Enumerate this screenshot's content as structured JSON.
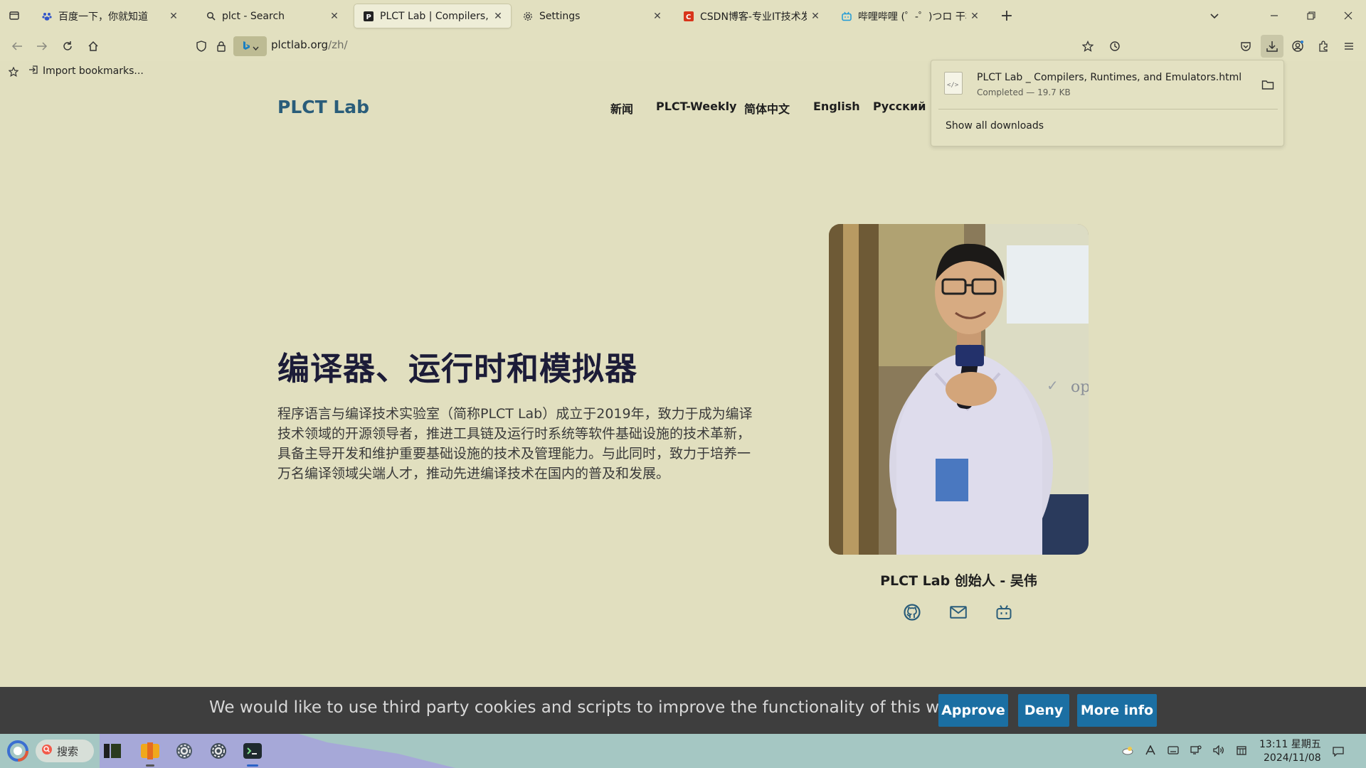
{
  "browser": {
    "tabs": [
      {
        "title": "百度一下，你就知道",
        "icon": "baidu-icon",
        "active": false
      },
      {
        "title": "plct - Search",
        "icon": "search-icon",
        "active": false
      },
      {
        "title": "PLCT Lab | Compilers, Runt",
        "icon": "plct-favicon",
        "active": true
      },
      {
        "title": "Settings",
        "icon": "gear-icon",
        "active": false
      },
      {
        "title": "CSDN博客-专业IT技术发表平",
        "icon": "csdn-icon",
        "active": false
      },
      {
        "title": "哔哩哔哩 (゜-゜)つロ 干杯~",
        "icon": "bilibili-icon",
        "active": false
      }
    ],
    "url": {
      "host": "plctlab.org",
      "path": "/zh/"
    },
    "bookmarks": {
      "import_label": "Import bookmarks..."
    }
  },
  "downloads": {
    "file_name": "PLCT Lab _ Compilers, Runtimes, and Emulators.html",
    "status": "Completed — 19.7 KB",
    "show_all": "Show all downloads"
  },
  "site": {
    "brand": "PLCT Lab",
    "nav": [
      "新闻",
      "PLCT-Weekly",
      "简体中文",
      "English",
      "Русский"
    ],
    "hero": {
      "title": "编译器、运行时和模拟器",
      "description": "程序语言与编译技术实验室（简称PLCT Lab）成立于2019年，致力于成为编译技术领域的开源领导者，推进工具链及运行时系统等软件基础设施的技术革新， 具备主导开发和维护重要基础设施的技术及管理能力。与此同时，致力于培养一万名编译领域尖端人才，推动先进编译技术在国内的普及和发展。"
    },
    "photo": {
      "slide_text": "op"
    },
    "founder_caption": "PLCT Lab 创始人 - 吴伟",
    "social_icons": [
      "github-icon",
      "mail-icon",
      "bilibili-icon"
    ]
  },
  "cookie": {
    "message": "We would like to use third party cookies and scripts to improve the functionality of this website.",
    "approve": "Approve",
    "deny": "Deny",
    "more": "More info"
  },
  "taskbar": {
    "search_placeholder": "搜索",
    "time": "13:11 星期五",
    "date": "2024/11/08"
  },
  "colors": {
    "background": "#e1dfbf",
    "brand": "#2a5d7a",
    "title": "#1c1c38",
    "cookie_bar": "#3e3e3e",
    "cookie_button": "#1b6fa3",
    "taskbar": "#a5c7c3"
  }
}
